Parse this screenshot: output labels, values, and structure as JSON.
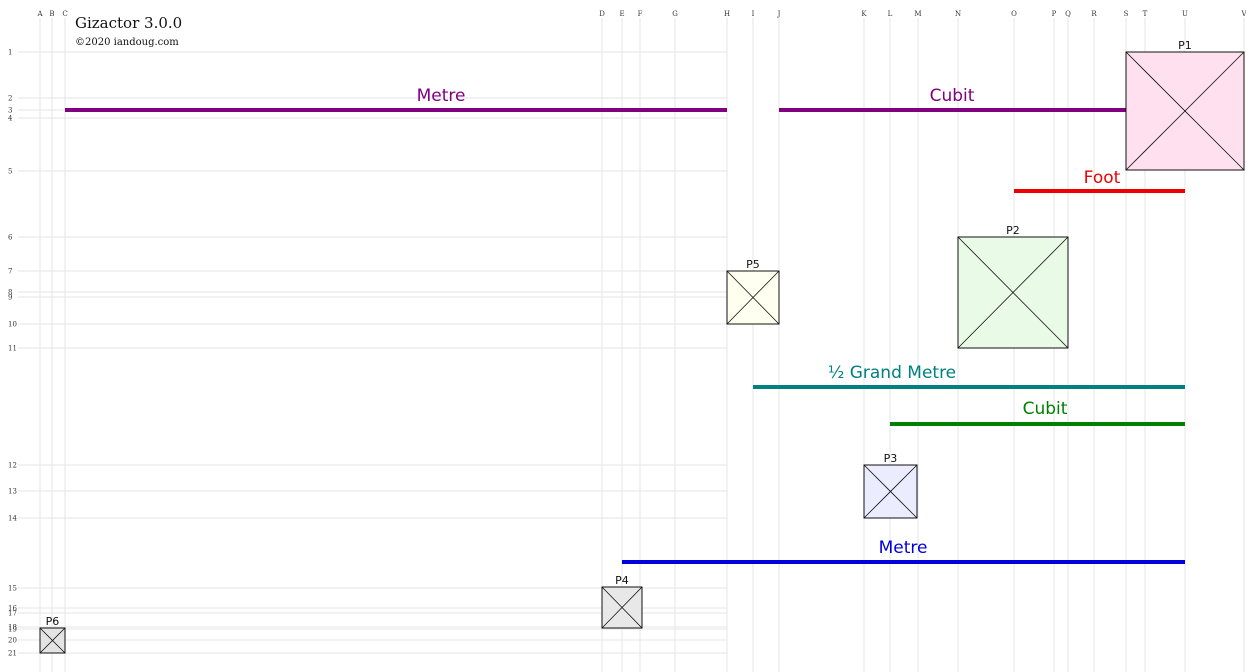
{
  "app": {
    "title": "Gizactor 3.0.0",
    "copyright": "©2020 iandoug.com"
  },
  "columns": [
    "A",
    "B",
    "C",
    "D",
    "E",
    "F",
    "G",
    "H",
    "I",
    "J",
    "K",
    "L",
    "M",
    "N",
    "O",
    "P",
    "Q",
    "R",
    "S",
    "T",
    "U",
    "V"
  ],
  "rows": [
    "1",
    "2",
    "3",
    "4",
    "5",
    "6",
    "7",
    "8",
    "9",
    "10",
    "11",
    "12",
    "13",
    "14",
    "15",
    "16",
    "17",
    "18",
    "19",
    "20",
    "21"
  ],
  "bars": [
    {
      "id": "metre-1",
      "label": "Metre",
      "color": "#800080"
    },
    {
      "id": "cubit-1",
      "label": "Cubit",
      "color": "#800080"
    },
    {
      "id": "foot",
      "label": "Foot",
      "color": "#ee0000"
    },
    {
      "id": "half-grand-metre",
      "label": "½ Grand Metre",
      "color": "#008080"
    },
    {
      "id": "cubit-2",
      "label": "Cubit",
      "color": "#008000"
    },
    {
      "id": "metre-2",
      "label": "Metre",
      "color": "#0000dd"
    }
  ],
  "panels": [
    {
      "id": "p1",
      "label": "P1",
      "fill": "#ffe0ee"
    },
    {
      "id": "p2",
      "label": "P2",
      "fill": "#e9fbe6"
    },
    {
      "id": "p3",
      "label": "P3",
      "fill": "#ececff"
    },
    {
      "id": "p4",
      "label": "P4",
      "fill": "#e8e8e8"
    },
    {
      "id": "p5",
      "label": "P5",
      "fill": "#fffff0"
    },
    {
      "id": "p6",
      "label": "P6",
      "fill": "#e4e4e4"
    }
  ]
}
